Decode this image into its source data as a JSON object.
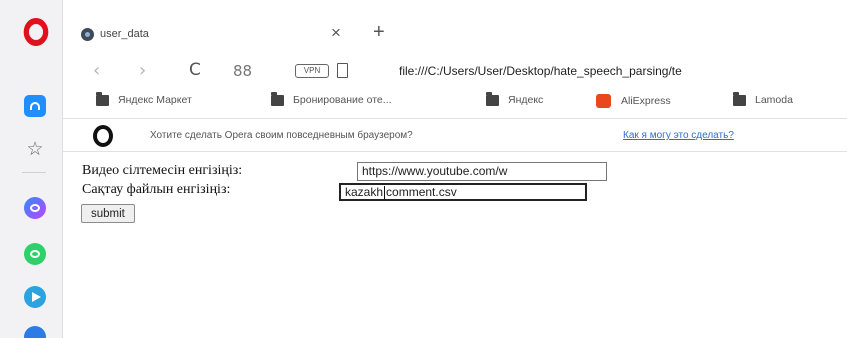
{
  "browser": {
    "tab": {
      "title": "user_data",
      "close_symbol": "×",
      "new_tab_symbol": "+"
    },
    "nav": {
      "back_symbol": "‹",
      "forward_symbol": "›",
      "reload_symbol": "C",
      "speed_dial_symbol": "88",
      "vpn_badge_text": "VPN",
      "address": "file:///C:/Users/User/Desktop/hate_speech_parsing/te"
    },
    "bookmarks": [
      {
        "label": "Яндекс Маркет",
        "icon": "folder-icon"
      },
      {
        "label": "Бронирование оте...",
        "icon": "folder-icon"
      },
      {
        "label": "Яндекс",
        "icon": "folder-icon"
      },
      {
        "label": "AliExpress",
        "icon": "aliexpress-icon",
        "color": "#e8481c"
      },
      {
        "label": "Lamoda",
        "icon": "folder-icon"
      }
    ],
    "infobar": {
      "message": "Хотите сделать Opera своим повседневным браузером?",
      "link": "Как я могу это сделать?"
    },
    "sidebar": {
      "star_symbol": "☆",
      "accent": "#1f8fff",
      "opera_red": "#e0101c"
    }
  },
  "page": {
    "form": {
      "url_label": "Видео сілтемесін енгізіңіз:",
      "url_value": "https://www.youtube.com/w",
      "file_label": "Сақтау файлын енгізіңіз:",
      "file_value_part1": "kazakh",
      "file_value_part2": "comment.csv",
      "submit_label": "submit"
    }
  }
}
